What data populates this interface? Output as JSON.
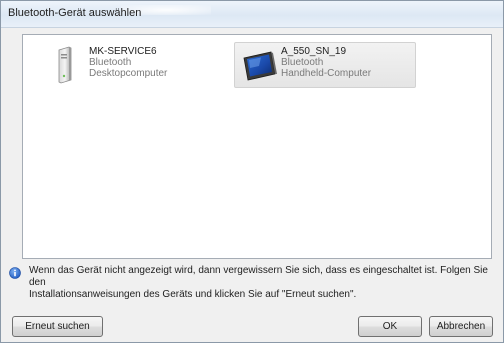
{
  "window": {
    "title": "Bluetooth-Gerät auswählen"
  },
  "devices": [
    {
      "name": "MK-SERVICE6",
      "transport": "Bluetooth",
      "type": "Desktopcomputer",
      "icon": "desktop-computer-icon",
      "selected": false
    },
    {
      "name": "A_550_SN_19",
      "transport": "Bluetooth",
      "type": "Handheld-Computer",
      "icon": "handheld-computer-icon",
      "selected": true
    }
  ],
  "info": {
    "icon": "info-icon",
    "text_line1": "Wenn das Gerät nicht angezeigt wird, dann vergewissern Sie sich, dass es eingeschaltet ist. Folgen Sie den",
    "text_line2": "Installationsanweisungen des Geräts und klicken Sie auf \"Erneut suchen\"."
  },
  "buttons": {
    "rescan": "Erneut suchen",
    "ok": "OK",
    "cancel": "Abbrechen"
  }
}
